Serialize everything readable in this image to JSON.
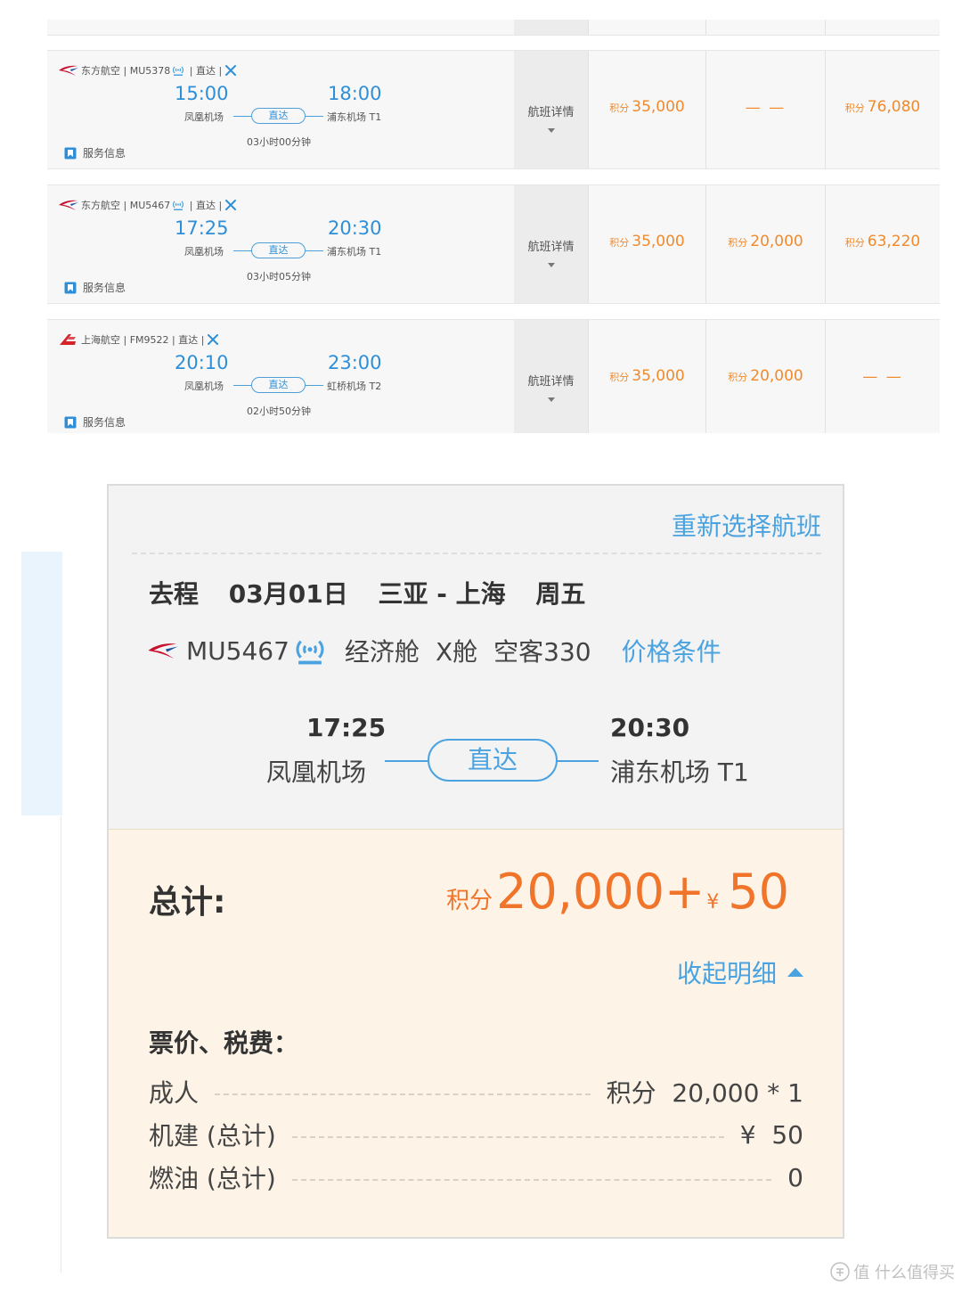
{
  "colors": {
    "accent_blue": "#4aa3e0",
    "time_blue": "#2e8fd8",
    "price_orange": "#f08a2c",
    "total_orange": "#f0752a",
    "eastern_red": "#c8102e",
    "shanghai_red": "#d6232a"
  },
  "flights": [
    {
      "airline": "东方航空",
      "flight_no": "MU5378",
      "direct": "直达",
      "logo_icon": "china-eastern-logo-icon",
      "has_wifi": true,
      "dep_time": "15:00",
      "arr_time": "18:00",
      "dep_airport": "凤凰机场",
      "arr_airport": "浦东机场 T1",
      "duration": "03小时00分钟",
      "service": "服务信息",
      "detail_label": "航班详情",
      "prices": [
        {
          "pts": "积分",
          "value": "35,000"
        },
        {
          "pts": "",
          "value": "— —"
        },
        {
          "pts": "积分",
          "value": "76,080"
        }
      ]
    },
    {
      "airline": "东方航空",
      "flight_no": "MU5467",
      "direct": "直达",
      "logo_icon": "china-eastern-logo-icon",
      "has_wifi": true,
      "dep_time": "17:25",
      "arr_time": "20:30",
      "dep_airport": "凤凰机场",
      "arr_airport": "浦东机场 T1",
      "duration": "03小时05分钟",
      "service": "服务信息",
      "detail_label": "航班详情",
      "prices": [
        {
          "pts": "积分",
          "value": "35,000"
        },
        {
          "pts": "积分",
          "value": "20,000"
        },
        {
          "pts": "积分",
          "value": "63,220"
        }
      ]
    },
    {
      "airline": "上海航空",
      "flight_no": "FM9522",
      "direct": "直达",
      "logo_icon": "shanghai-airlines-logo-icon",
      "has_wifi": false,
      "dep_time": "20:10",
      "arr_time": "23:00",
      "dep_airport": "凤凰机场",
      "arr_airport": "虹桥机场 T2",
      "duration": "02小时50分钟",
      "service": "服务信息",
      "detail_label": "航班详情",
      "prices": [
        {
          "pts": "积分",
          "value": "35,000"
        },
        {
          "pts": "积分",
          "value": "20,000"
        },
        {
          "pts": "",
          "value": "— —"
        }
      ]
    }
  ],
  "summary": {
    "reselect": "重新选择航班",
    "trip_type": "去程",
    "date": "03月01日",
    "route": "三亚 - 上海",
    "weekday": "周五",
    "flight_no": "MU5467",
    "cabin_class": "经济舱",
    "cabin_code": "X舱",
    "aircraft": "空客330",
    "price_conditions": "价格条件",
    "dep_time": "17:25",
    "arr_time": "20:30",
    "dep_airport": "凤凰机场",
    "arr_airport": "浦东机场 T1",
    "direct": "直达",
    "total_label": "总计:",
    "total_pts_label": "积分",
    "total_points": "20,000",
    "total_plus": "+",
    "total_yen": "¥",
    "total_cash": "50",
    "collapse": "收起明细",
    "fee_title": "票价、税费：",
    "fees": [
      {
        "label": "成人",
        "value": "积分  20,000 * 1"
      },
      {
        "label": "机建 (总计)",
        "value": "¥  50"
      },
      {
        "label": "燃油 (总计)",
        "value": "0"
      }
    ]
  },
  "watermark": "值 什么值得买"
}
